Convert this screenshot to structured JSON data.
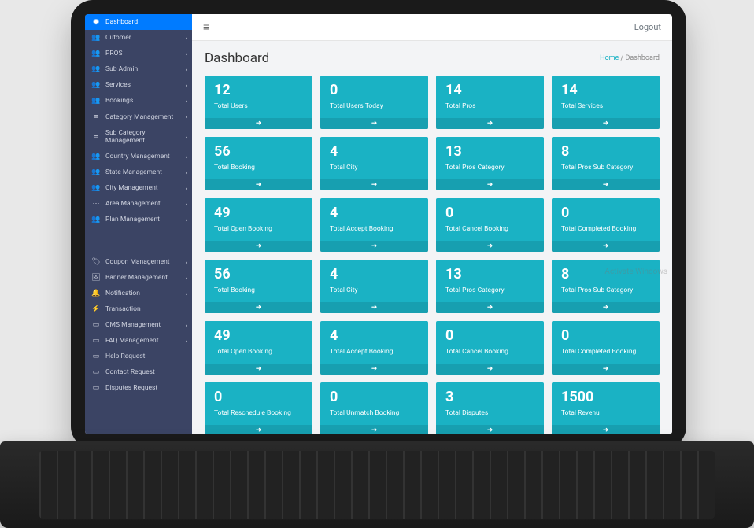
{
  "topbar": {
    "logout": "Logout"
  },
  "page": {
    "title": "Dashboard",
    "breadcrumb_home": "Home",
    "breadcrumb_sep": " / ",
    "breadcrumb_current": "Dashboard"
  },
  "watermark": "Activate Windows",
  "sidebar": {
    "items": [
      {
        "label": "Dashboard",
        "icon": "dashboard",
        "active": true
      },
      {
        "label": "Cutomer",
        "icon": "users",
        "expandable": true
      },
      {
        "label": "PROS",
        "icon": "users",
        "expandable": true
      },
      {
        "label": "Sub Admin",
        "icon": "users",
        "expandable": true
      },
      {
        "label": "Services",
        "icon": "users",
        "expandable": true
      },
      {
        "label": "Bookings",
        "icon": "users",
        "expandable": true
      },
      {
        "label": "Category Management",
        "icon": "list",
        "expandable": true
      },
      {
        "label": "Sub Category Management",
        "icon": "list",
        "expandable": true
      },
      {
        "label": "Country Management",
        "icon": "users",
        "expandable": true
      },
      {
        "label": "State Management",
        "icon": "users",
        "expandable": true
      },
      {
        "label": "City Management",
        "icon": "users",
        "expandable": true
      },
      {
        "label": "Area Management",
        "icon": "dots",
        "expandable": true
      },
      {
        "label": "Plan Management",
        "icon": "users",
        "expandable": true
      }
    ],
    "items2": [
      {
        "label": "Coupon Management",
        "icon": "tag",
        "expandable": true
      },
      {
        "label": "Banner Management",
        "icon": "image",
        "expandable": true
      },
      {
        "label": "Notification",
        "icon": "bell",
        "expandable": true
      },
      {
        "label": "Transaction",
        "icon": "lightning"
      },
      {
        "label": "CMS Management",
        "icon": "cms",
        "expandable": true
      },
      {
        "label": "FAQ Management",
        "icon": "faq",
        "expandable": true
      },
      {
        "label": "Help Request",
        "icon": "help"
      },
      {
        "label": "Contact Request",
        "icon": "contact"
      },
      {
        "label": "Disputes Request",
        "icon": "disputes"
      }
    ]
  },
  "cards": [
    {
      "value": "12",
      "label": "Total Users"
    },
    {
      "value": "0",
      "label": "Total Users Today"
    },
    {
      "value": "14",
      "label": "Total Pros"
    },
    {
      "value": "14",
      "label": "Total Services"
    },
    {
      "value": "56",
      "label": "Total Booking"
    },
    {
      "value": "4",
      "label": "Total City"
    },
    {
      "value": "13",
      "label": "Total Pros Category"
    },
    {
      "value": "8",
      "label": "Total Pros Sub Category"
    },
    {
      "value": "49",
      "label": "Total Open Booking"
    },
    {
      "value": "4",
      "label": "Total Accept Booking"
    },
    {
      "value": "0",
      "label": "Total Cancel Booking"
    },
    {
      "value": "0",
      "label": "Total Completed Booking"
    },
    {
      "value": "56",
      "label": "Total Booking"
    },
    {
      "value": "4",
      "label": "Total City"
    },
    {
      "value": "13",
      "label": "Total Pros Category"
    },
    {
      "value": "8",
      "label": "Total Pros Sub Category"
    },
    {
      "value": "49",
      "label": "Total Open Booking"
    },
    {
      "value": "4",
      "label": "Total Accept Booking"
    },
    {
      "value": "0",
      "label": "Total Cancel Booking"
    },
    {
      "value": "0",
      "label": "Total Completed Booking"
    },
    {
      "value": "0",
      "label": "Total Reschedule Booking"
    },
    {
      "value": "0",
      "label": "Total Unmatch Booking"
    },
    {
      "value": "3",
      "label": "Total Disputes"
    },
    {
      "value": "1500",
      "label": "Total Revenu"
    }
  ]
}
